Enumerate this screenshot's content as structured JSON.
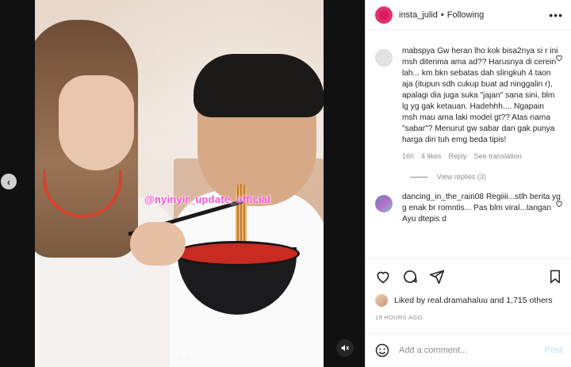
{
  "post": {
    "username": "insta_julid",
    "separator": "•",
    "follow_status": "Following",
    "watermark": "@nyinyir_update_official",
    "carousel_dots": 3,
    "active_dot": 1
  },
  "comments": [
    {
      "username": "mabspya",
      "text": "Gw heran lho kok bisa2nya si r ini msh diterima ama ad?? Harusnya di cerein lah... km bkn sebatas dah slingkuh 4 taon aja (itupun sdh cukup buat ad ninggalin r), apalagi dia juga suka \"jajan\" sana sini, blm lg yg gak ketauan. Hadehhh.... Ngapain msh mau ama laki model gt?? Atas nama \"sabar\"? Menurut gw sabar dan gak punya harga diri tuh emg beda tipis!",
      "time": "16h",
      "likes": "4 likes",
      "reply": "Reply",
      "translate": "See translation",
      "view_replies": "View replies (3)"
    },
    {
      "username": "dancing_in_the_rain08",
      "text": "Regiiii...stlh berita yg g enak br romntis... Pas blm viral...tangan Ayu dtepis d"
    }
  ],
  "likes_line": {
    "prefix": "Liked by",
    "user": "real.dramahaluu",
    "suffix": "and 1,715 others"
  },
  "timestamp": "19 HOURS AGO",
  "add_comment": {
    "placeholder": "Add a comment...",
    "post_label": "Post"
  },
  "icons": {
    "more": "more-icon",
    "like": "heart-icon",
    "comment": "comment-icon",
    "share": "send-icon",
    "save": "bookmark-icon",
    "emoji": "emoji-icon",
    "prev": "chevron-left-icon",
    "sound": "speaker-muted-icon"
  }
}
